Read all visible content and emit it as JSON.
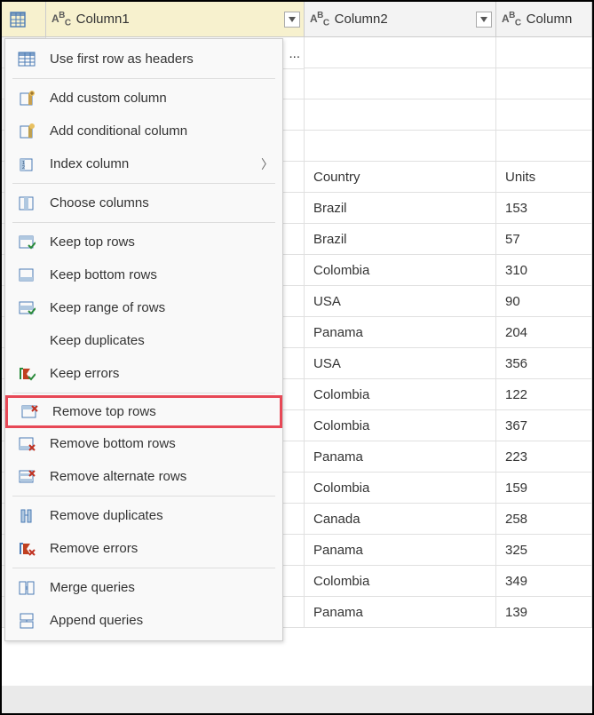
{
  "columns": {
    "col1": "Column1",
    "col2": "Column2",
    "col3": "Column"
  },
  "rows": [
    {
      "c2": "",
      "c3": ""
    },
    {
      "c2": "",
      "c3": ""
    },
    {
      "c2": "",
      "c3": ""
    },
    {
      "c2": "",
      "c3": ""
    },
    {
      "c2": "Country",
      "c3": "Units"
    },
    {
      "c2": "Brazil",
      "c3": "153"
    },
    {
      "c2": "Brazil",
      "c3": "57"
    },
    {
      "c2": "Colombia",
      "c3": "310"
    },
    {
      "c2": "USA",
      "c3": "90"
    },
    {
      "c2": "Panama",
      "c3": "204"
    },
    {
      "c2": "USA",
      "c3": "356"
    },
    {
      "c2": "Colombia",
      "c3": "122"
    },
    {
      "c2": "Colombia",
      "c3": "367"
    },
    {
      "c2": "Panama",
      "c3": "223"
    },
    {
      "c2": "Colombia",
      "c3": "159"
    },
    {
      "c2": "Canada",
      "c3": "258"
    },
    {
      "c2": "Panama",
      "c3": "325"
    },
    {
      "c2": "Colombia",
      "c3": "349"
    },
    {
      "c2": "Panama",
      "c3": "139"
    }
  ],
  "peek_text": "...",
  "menu": {
    "headers": "Use first row as headers",
    "add_custom": "Add custom column",
    "add_conditional": "Add conditional column",
    "index": "Index column",
    "choose": "Choose columns",
    "keep_top": "Keep top rows",
    "keep_bottom": "Keep bottom rows",
    "keep_range": "Keep range of rows",
    "keep_dup": "Keep duplicates",
    "keep_err": "Keep errors",
    "remove_top": "Remove top rows",
    "remove_bottom": "Remove bottom rows",
    "remove_alt": "Remove alternate rows",
    "remove_dup": "Remove duplicates",
    "remove_err": "Remove errors",
    "merge": "Merge queries",
    "append": "Append queries"
  }
}
